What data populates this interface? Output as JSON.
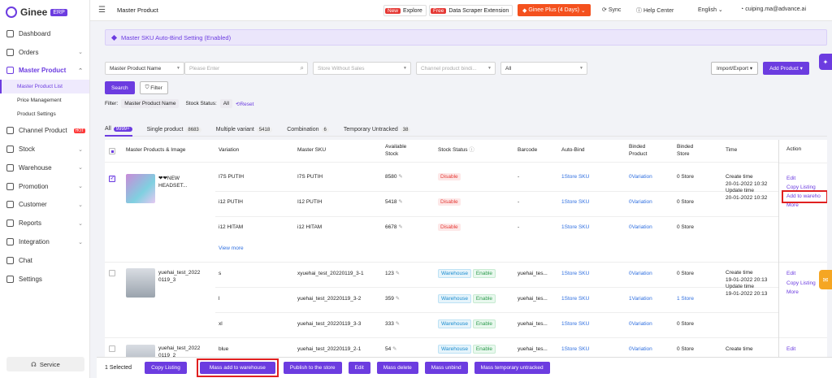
{
  "brand": {
    "name": "Ginee",
    "badge": "ERP"
  },
  "sidebar": {
    "items": [
      {
        "label": "Dashboard"
      },
      {
        "label": "Orders"
      },
      {
        "label": "Master Product"
      },
      {
        "label": "Channel Product",
        "badge": "HOT"
      },
      {
        "label": "Stock"
      },
      {
        "label": "Warehouse"
      },
      {
        "label": "Promotion"
      },
      {
        "label": "Customer"
      },
      {
        "label": "Reports"
      },
      {
        "label": "Integration"
      },
      {
        "label": "Chat"
      },
      {
        "label": "Settings"
      }
    ],
    "sub_items": [
      {
        "label": "Master Product List"
      },
      {
        "label": "Price Management"
      },
      {
        "label": "Product Settings"
      }
    ],
    "service": "Service"
  },
  "topbar": {
    "title": "Master Product",
    "explore_tag": "New",
    "explore_label": "Explore",
    "scraper_tag": "Free",
    "scraper_label": "Data Scraper Extension",
    "plus_label": "Ginee Plus (4 Days)",
    "sync": "Sync",
    "help": "Help Center",
    "language": "English",
    "user": "cuiping.ma@advance.ai"
  },
  "banner": {
    "text": "Master SKU Auto-Bind Setting (Enabled)"
  },
  "filters": {
    "field_select": "Master Product Name",
    "search_placeholder": "Please Enter",
    "store_placeholder": "Store Without Sales",
    "channel_placeholder": "Channel product bindi...",
    "all_select": "All",
    "import_export": "Import/Export",
    "add_product": "Add Product",
    "search_btn": "Search",
    "filter_btn": "Filter",
    "filter_prefix": "Filter:",
    "filter_chip": "Master Product Name",
    "stock_status_label": "Stock Status:",
    "stock_status_chip": "All",
    "reset": "Reset"
  },
  "tabs": [
    {
      "label": "All",
      "count": "9999+"
    },
    {
      "label": "Single product",
      "count": "8683"
    },
    {
      "label": "Multiple variant",
      "count": "5418"
    },
    {
      "label": "Combination",
      "count": "6"
    },
    {
      "label": "Temporary Untracked",
      "count": "38"
    }
  ],
  "table": {
    "headers": {
      "product": "Master Products & Image",
      "variation": "Variation",
      "sku": "Master SKU",
      "available_1": "Available",
      "available_2": "Stock",
      "stock_status": "Stock Status",
      "barcode": "Barcode",
      "autobind": "Auto-Bind",
      "binded_product_1": "Binded",
      "binded_product_2": "Product",
      "binded_store_1": "Binded",
      "binded_store_2": "Store",
      "time": "Time",
      "action": "Action"
    },
    "products": [
      {
        "name_1": "❤❤NEW",
        "name_2": "HEADSET...",
        "time_create_label": "Create time",
        "time_create": "20-01-2022 10:32",
        "time_update_label": "Update time",
        "time_update": "20-01-2022 10:32",
        "actions": [
          "Edit",
          "Copy Listing",
          "Add to wareho",
          "More"
        ],
        "view_more": "View more",
        "rows": [
          {
            "variation": "I7S PUTIH",
            "sku": "I7S PUTIH",
            "stock": "8580",
            "status": "Disable",
            "barcode": "-",
            "autobind": "1Store SKU",
            "bproduct": "0Variation",
            "bstore": "0 Store"
          },
          {
            "variation": "i12 PUTIH",
            "sku": "I12 PUTIH",
            "stock": "5418",
            "status": "Disable",
            "barcode": "-",
            "autobind": "1Store SKU",
            "bproduct": "0Variation",
            "bstore": "0 Store"
          },
          {
            "variation": "i12 HITAM",
            "sku": "i12 HITAM",
            "stock": "6678",
            "status": "Disable",
            "barcode": "-",
            "autobind": "1Store SKU",
            "bproduct": "0Variation",
            "bstore": "0 Store"
          }
        ]
      },
      {
        "name_1": "yuehai_test_2022",
        "name_2": "0119_3",
        "time_create_label": "Create time",
        "time_create": "19-01-2022 20:13",
        "time_update_label": "Update time",
        "time_update": "19-01-2022 20:13",
        "actions": [
          "Edit",
          "Copy Listing",
          "More"
        ],
        "rows": [
          {
            "variation": "s",
            "sku": "xyuehai_test_20220119_3-1",
            "stock": "123",
            "status": "Warehouse",
            "status2": "Enable",
            "barcode": "yuehai_tes...",
            "autobind": "1Store SKU",
            "bproduct": "0Variation",
            "bstore": "0 Store"
          },
          {
            "variation": "l",
            "sku": "yuehai_test_20220119_3-2",
            "stock": "359",
            "status": "Warehouse",
            "status2": "Enable",
            "barcode": "yuehai_tes...",
            "autobind": "1Store SKU",
            "bproduct": "1Variation",
            "bstore": "1 Store"
          },
          {
            "variation": "xl",
            "sku": "yuehai_test_20220119_3-3",
            "stock": "333",
            "status": "Warehouse",
            "status2": "Enable",
            "barcode": "yuehai_tes...",
            "autobind": "1Store SKU",
            "bproduct": "0Variation",
            "bstore": "0 Store"
          }
        ]
      },
      {
        "name_1": "yuehai_test_2022",
        "name_2": "0119_2",
        "time_create_label": "Create time",
        "actions": [
          "Edit"
        ],
        "rows": [
          {
            "variation": "blue",
            "sku": "yuehai_test_20220119_2-1",
            "stock": "54",
            "status": "Warehouse",
            "status2": "Enable",
            "barcode": "yuehai_tes...",
            "autobind": "1Store SKU",
            "bproduct": "0Variation",
            "bstore": "0 Store"
          }
        ]
      }
    ]
  },
  "bottom": {
    "selected": "1 Selected",
    "buttons": [
      "Copy Listing",
      "Mass add to warehouse",
      "Publish to the store",
      "Edit",
      "Mass delete",
      "Mass unbind",
      "Mass temporary untracked"
    ]
  },
  "colors": {
    "accent": "#6c3ce0",
    "danger": "#e53935",
    "highlight": "#e02020"
  }
}
